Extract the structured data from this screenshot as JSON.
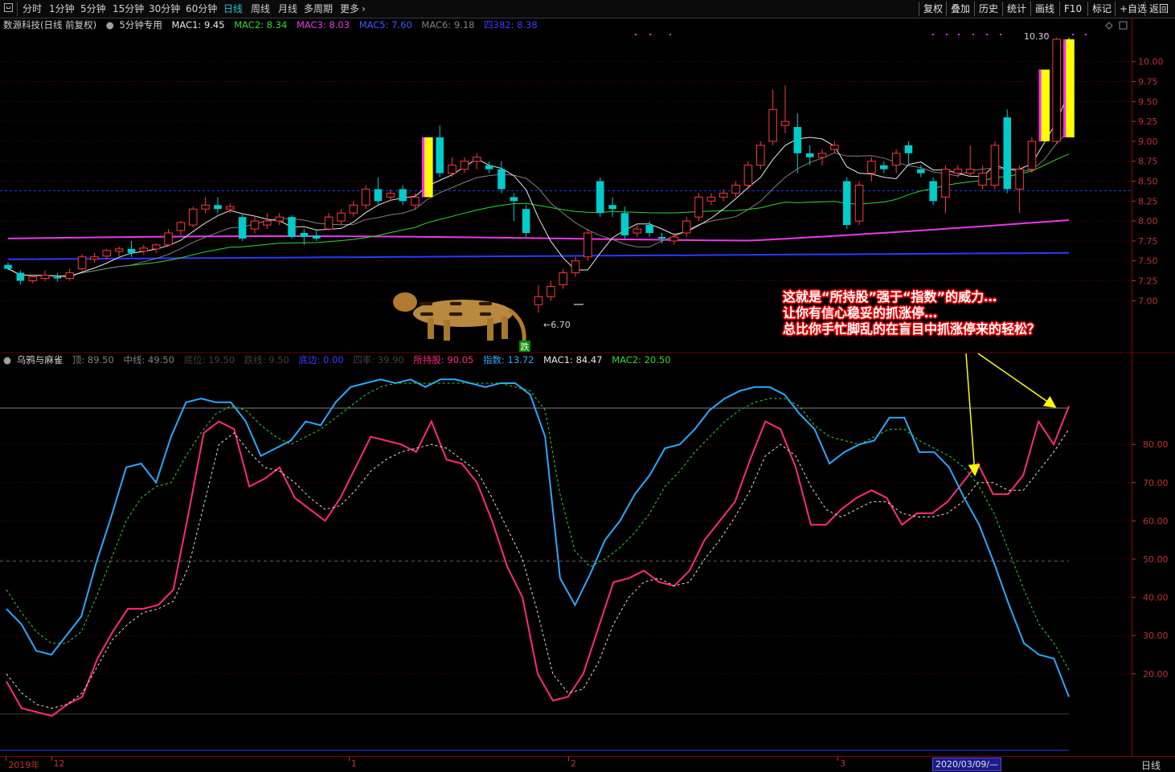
{
  "toolbar": {
    "periods": [
      "分时",
      "1分钟",
      "5分钟",
      "15分钟",
      "30分钟",
      "60分钟",
      "日线",
      "周线",
      "月线",
      "多周期",
      "更多"
    ],
    "active_period": "日线",
    "right_buttons": [
      "复权",
      "叠加",
      "历史",
      "统计",
      "画线",
      "F10",
      "标记",
      "+自选",
      "返回"
    ]
  },
  "main_info": {
    "stock": "数源科技(日线 前复权)",
    "formula": "5分钟专用",
    "items": [
      {
        "label": "MAC1: 9.45",
        "color": "#e8e8e8"
      },
      {
        "label": "MAC2: 8.34",
        "color": "#33d633"
      },
      {
        "label": "MAC3: 8.03",
        "color": "#e83ae8"
      },
      {
        "label": "MAC5: 7.60",
        "color": "#3a5aff"
      },
      {
        "label": "MAC6: 9.18",
        "color": "#808080"
      },
      {
        "label": "四382: 8.38",
        "color": "#3a3aff"
      }
    ]
  },
  "sub_info": {
    "name": "乌鸦与麻雀",
    "items": [
      {
        "label": "顶: 89.50",
        "color": "#808080"
      },
      {
        "label": "中线: 49.50",
        "color": "#808080"
      },
      {
        "label": "底位: 19.50",
        "color": "#404040"
      },
      {
        "label": "跌线: 9.50",
        "color": "#404040"
      },
      {
        "label": "底边: 0.00",
        "color": "#3a3aff"
      },
      {
        "label": "四率: 39.90",
        "color": "#404040"
      },
      {
        "label": "所持股: 90.05",
        "color": "#ff2a7a"
      },
      {
        "label": "指数: 13.72",
        "color": "#2aa8ff"
      },
      {
        "label": "MAC1: 84.47",
        "color": "#e8e8e8"
      },
      {
        "label": "MAC2: 20.50",
        "color": "#33d633"
      }
    ]
  },
  "annotation": {
    "lines": [
      "这就是“所持股”强于“指数”的威力…",
      "让你有信心稳妥的抓涨停…",
      "总比你手忙脚乱的在盲目中抓涨停来的轻松？"
    ]
  },
  "marks": {
    "high_label": "10.30",
    "low_label": "6.70",
    "low_arrow": "←",
    "drop_badge": "跌"
  },
  "bottom_axis": {
    "labels": [
      {
        "text": "2019年",
        "pos": 0.003
      },
      {
        "text": "12",
        "pos": 0.043
      },
      {
        "text": "1",
        "pos": 0.306
      },
      {
        "text": "2",
        "pos": 0.5
      },
      {
        "text": "3",
        "pos": 0.738
      }
    ],
    "cursor_date": "2020/03/09/—",
    "period": "日线"
  },
  "colors": {
    "up": "#ff3a3a",
    "down": "#00cccc",
    "limit": "#ffff00",
    "limit_inner": "#ff2aff"
  },
  "chart_data": [
    {
      "type": "candlestick",
      "y_axis_ticks": [
        7.0,
        7.25,
        7.5,
        7.75,
        8.0,
        8.25,
        8.5,
        8.75,
        9.0,
        9.25,
        9.5,
        9.75,
        10.0
      ],
      "ylim": [
        6.6,
        10.35
      ],
      "candles": [
        [
          7.45,
          7.4,
          7.48,
          7.38
        ],
        [
          7.35,
          7.25,
          7.38,
          7.2
        ],
        [
          7.25,
          7.3,
          7.33,
          7.22
        ],
        [
          7.28,
          7.32,
          7.38,
          7.25
        ],
        [
          7.3,
          7.28,
          7.35,
          7.24
        ],
        [
          7.28,
          7.35,
          7.4,
          7.25
        ],
        [
          7.4,
          7.55,
          7.58,
          7.38
        ],
        [
          7.52,
          7.55,
          7.6,
          7.48
        ],
        [
          7.56,
          7.63,
          7.65,
          7.52
        ],
        [
          7.62,
          7.65,
          7.68,
          7.56
        ],
        [
          7.65,
          7.6,
          7.75,
          7.55
        ],
        [
          7.62,
          7.66,
          7.7,
          7.58
        ],
        [
          7.65,
          7.7,
          7.72,
          7.6
        ],
        [
          7.7,
          7.85,
          7.9,
          7.68
        ],
        [
          7.88,
          7.98,
          8.0,
          7.82
        ],
        [
          7.95,
          8.15,
          8.18,
          7.92
        ],
        [
          8.15,
          8.2,
          8.3,
          8.1
        ],
        [
          8.2,
          8.15,
          8.3,
          8.1
        ],
        [
          8.15,
          8.18,
          8.22,
          8.1
        ],
        [
          8.05,
          7.78,
          8.08,
          7.75
        ],
        [
          7.9,
          8.0,
          8.05,
          7.85
        ],
        [
          7.95,
          8.0,
          8.1,
          7.9
        ],
        [
          8.0,
          8.05,
          8.1,
          7.95
        ],
        [
          8.05,
          7.8,
          8.07,
          7.78
        ],
        [
          7.85,
          7.8,
          7.9,
          7.7
        ],
        [
          7.82,
          7.78,
          7.9,
          7.75
        ],
        [
          7.9,
          8.05,
          8.1,
          7.88
        ],
        [
          8.0,
          8.1,
          8.15,
          7.95
        ],
        [
          8.1,
          8.2,
          8.25,
          8.05
        ],
        [
          8.2,
          8.4,
          8.45,
          8.15
        ],
        [
          8.4,
          8.25,
          8.55,
          8.2
        ],
        [
          8.3,
          8.35,
          8.4,
          8.25
        ],
        [
          8.4,
          8.25,
          8.45,
          8.2
        ],
        [
          8.2,
          8.3,
          8.35,
          8.15
        ],
        [
          8.3,
          9.05,
          9.05,
          8.3
        ],
        [
          9.05,
          8.6,
          9.2,
          8.55
        ],
        [
          8.6,
          8.7,
          8.8,
          8.55
        ],
        [
          8.65,
          8.75,
          8.8,
          8.6
        ],
        [
          8.75,
          8.8,
          8.85,
          8.65
        ],
        [
          8.7,
          8.65,
          8.75,
          8.6
        ],
        [
          8.65,
          8.4,
          8.75,
          8.35
        ],
        [
          8.3,
          8.25,
          8.35,
          8.0
        ],
        [
          8.15,
          7.85,
          8.2,
          7.8
        ],
        [
          6.95,
          7.05,
          7.2,
          6.85
        ],
        [
          7.05,
          7.18,
          7.25,
          7.0
        ],
        [
          7.2,
          7.35,
          7.4,
          7.15
        ],
        [
          7.35,
          7.5,
          7.55,
          7.3
        ],
        [
          7.55,
          7.85,
          7.9,
          7.5
        ],
        [
          8.5,
          8.1,
          8.55,
          8.05
        ],
        [
          8.2,
          8.15,
          8.3,
          8.05
        ],
        [
          8.1,
          7.82,
          8.18,
          7.78
        ],
        [
          7.85,
          7.9,
          7.95,
          7.8
        ],
        [
          7.95,
          7.85,
          8.0,
          7.8
        ],
        [
          7.8,
          7.78,
          7.85,
          7.72
        ],
        [
          7.75,
          7.8,
          7.85,
          7.7
        ],
        [
          7.85,
          8.0,
          8.05,
          7.8
        ],
        [
          8.05,
          8.3,
          8.35,
          8.0
        ],
        [
          8.25,
          8.3,
          8.35,
          8.2
        ],
        [
          8.3,
          8.35,
          8.4,
          8.25
        ],
        [
          8.35,
          8.45,
          8.5,
          8.3
        ],
        [
          8.45,
          8.7,
          8.75,
          8.4
        ],
        [
          8.7,
          8.95,
          9.0,
          8.65
        ],
        [
          9.0,
          9.4,
          9.65,
          8.95
        ],
        [
          9.2,
          9.25,
          9.7,
          9.1
        ],
        [
          9.18,
          8.85,
          9.35,
          8.6
        ],
        [
          8.85,
          8.8,
          8.95,
          8.7
        ],
        [
          8.8,
          8.85,
          8.9,
          8.7
        ],
        [
          8.9,
          8.95,
          9.0,
          8.85
        ],
        [
          8.5,
          7.95,
          8.55,
          7.9
        ],
        [
          8.0,
          8.45,
          8.5,
          7.95
        ],
        [
          8.6,
          8.75,
          8.8,
          8.5
        ],
        [
          8.7,
          8.65,
          8.75,
          8.6
        ],
        [
          8.7,
          8.85,
          8.9,
          8.6
        ],
        [
          8.95,
          8.85,
          9.0,
          8.7
        ],
        [
          8.65,
          8.6,
          8.7,
          8.55
        ],
        [
          8.5,
          8.25,
          8.55,
          8.2
        ],
        [
          8.3,
          8.65,
          8.7,
          8.1
        ],
        [
          8.6,
          8.65,
          8.7,
          8.55
        ],
        [
          8.6,
          8.65,
          8.95,
          8.55
        ],
        [
          8.45,
          8.6,
          8.7,
          8.4
        ],
        [
          8.45,
          8.95,
          9.0,
          8.4
        ],
        [
          9.3,
          8.4,
          9.4,
          8.35
        ],
        [
          8.4,
          8.65,
          8.7,
          8.1
        ],
        [
          8.65,
          9.0,
          9.05,
          8.6
        ],
        [
          9.0,
          9.9,
          9.9,
          9.0
        ],
        [
          9.0,
          10.28,
          10.3,
          8.98
        ],
        [
          9.05,
          10.28,
          10.3,
          9.05
        ]
      ],
      "limit_up_indices": [
        34,
        84,
        86
      ],
      "mac_levels": {
        "MAC5": 7.6,
        "四382": 8.38
      }
    },
    {
      "type": "line",
      "y_axis_ticks": [
        20,
        30,
        40,
        50,
        60,
        70,
        80
      ],
      "ylim": [
        0,
        100
      ],
      "reference_lines": [
        89.5,
        49.5,
        9.5,
        0.0
      ],
      "series": [
        {
          "name": "所持股",
          "color": "#ff2a7a",
          "values": [
            18,
            11,
            10,
            9,
            12,
            14,
            24,
            31,
            37,
            37,
            38,
            42,
            62,
            83,
            86,
            84,
            69,
            71,
            74,
            66,
            63,
            60,
            66,
            74,
            82,
            81,
            80,
            78,
            86,
            76,
            75,
            70,
            60,
            48,
            40,
            20,
            13,
            14,
            20,
            32,
            44,
            45,
            47,
            44,
            43,
            47,
            55,
            60,
            65,
            76,
            86,
            84,
            74,
            59,
            59,
            63,
            66,
            68,
            66,
            59,
            62,
            62,
            65,
            70,
            75,
            67,
            67,
            72,
            86,
            80,
            90
          ]
        },
        {
          "name": "指数",
          "color": "#2aa8ff",
          "values": [
            37,
            33,
            26,
            25,
            30,
            35,
            49,
            61,
            74,
            75,
            70,
            82,
            91,
            92,
            91,
            91,
            86,
            77,
            79,
            81,
            86,
            85,
            91,
            95,
            96,
            97,
            96,
            97,
            95,
            97,
            97,
            96,
            95,
            96,
            96,
            93,
            82,
            45,
            38,
            46,
            55,
            60,
            67,
            72,
            79,
            80,
            84,
            89,
            92,
            94,
            95,
            95,
            93,
            88,
            84,
            75,
            78,
            80,
            81,
            87,
            87,
            78,
            78,
            74,
            66,
            59,
            49,
            38,
            28,
            25,
            24,
            14
          ]
        },
        {
          "name": "MAC1",
          "color": "#e0e0e0",
          "values": [
            20,
            15,
            12,
            11,
            12,
            15,
            22,
            29,
            33,
            36,
            37,
            39,
            48,
            64,
            80,
            83,
            78,
            74,
            73,
            70,
            66,
            63,
            64,
            68,
            73,
            76,
            78,
            79,
            80,
            79,
            76,
            73,
            66,
            58,
            50,
            36,
            20,
            15,
            16,
            23,
            33,
            40,
            44,
            45,
            43,
            44,
            50,
            55,
            61,
            68,
            77,
            80,
            77,
            69,
            63,
            61,
            63,
            65,
            65,
            62,
            61,
            61,
            62,
            65,
            70,
            70,
            68,
            68,
            73,
            78,
            84
          ]
        },
        {
          "name": "MAC2",
          "color": "#33d633",
          "values": [
            42,
            36,
            31,
            28,
            28,
            31,
            40,
            50,
            60,
            66,
            69,
            70,
            77,
            83,
            88,
            90,
            89,
            85,
            82,
            80,
            82,
            84,
            87,
            90,
            93,
            95,
            96,
            96,
            96,
            96,
            96,
            96,
            96,
            96,
            95,
            94,
            89,
            67,
            52,
            48,
            50,
            53,
            57,
            62,
            69,
            73,
            78,
            82,
            86,
            89,
            91,
            92,
            92,
            90,
            85,
            82,
            81,
            80,
            82,
            84,
            84,
            81,
            79,
            77,
            74,
            69,
            62,
            52,
            42,
            33,
            28,
            21
          ]
        }
      ]
    }
  ]
}
